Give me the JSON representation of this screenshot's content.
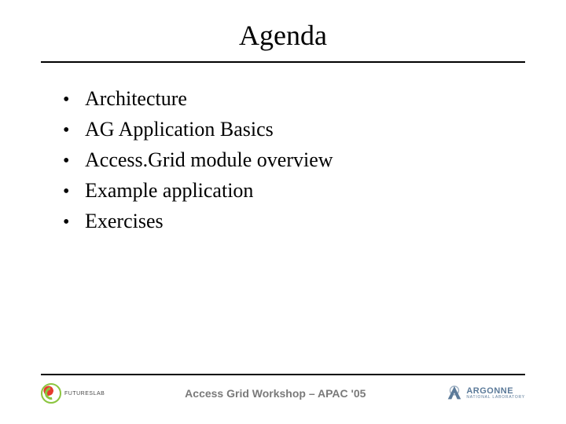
{
  "title": "Agenda",
  "bullets": [
    "Architecture",
    "AG Application Basics",
    "Access.Grid module overview",
    "Example application",
    "Exercises"
  ],
  "footer": {
    "left_logo_label": "FUTURESLAB",
    "center_text": "Access Grid Workshop – APAC '05",
    "right_logo_name": "ARGONNE",
    "right_logo_sub": "NATIONAL LABORATORY"
  }
}
